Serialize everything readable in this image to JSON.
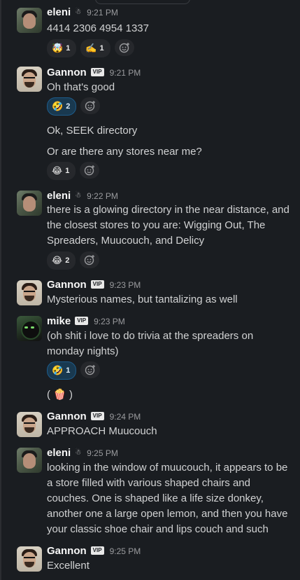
{
  "messages": [
    {
      "author": "eleni",
      "badge_icon": "snowman-icon",
      "badge": "☃",
      "time": "9:21 PM",
      "lines": [
        "4414 2306 4954 1337"
      ],
      "reactions": [
        {
          "emoji": "🤯",
          "icon": "exploding-head-icon",
          "count": "1",
          "active": false
        },
        {
          "emoji": "✍️",
          "icon": "writing-hand-icon",
          "count": "1",
          "active": false
        }
      ]
    },
    {
      "author": "Gannon",
      "vip": "VIP",
      "time": "9:21 PM",
      "lines": [
        "Oh that's good"
      ],
      "reactions": [
        {
          "emoji": "🤣",
          "icon": "rofl-icon",
          "count": "2",
          "active": true
        }
      ]
    },
    {
      "author": "",
      "time": "",
      "lines": [
        "Ok, SEEK directory"
      ]
    },
    {
      "author": "",
      "time": "",
      "lines": [
        "Or are there any stores near me?"
      ],
      "reactions": [
        {
          "emoji": "😂",
          "icon": "joy-icon",
          "count": "1",
          "active": false
        }
      ]
    },
    {
      "author": "eleni",
      "badge_icon": "snowman-icon",
      "badge": "☃",
      "time": "9:22 PM",
      "text": "there is a glowing directory in the near distance, and the closest stores to you are: Wigging Out, The Spreaders, Muucouch, and Delicy",
      "reactions": [
        {
          "emoji": "😂",
          "icon": "joy-icon",
          "count": "2",
          "active": false
        }
      ]
    },
    {
      "author": "Gannon",
      "vip": "VIP",
      "time": "9:23 PM",
      "text": "Mysterious names, but tantalizing as well"
    },
    {
      "author": "mike",
      "vip": "VIP",
      "time": "9:23 PM",
      "text": "(oh shit i love to do trivia at the spreaders on monday nights)",
      "reactions": [
        {
          "emoji": "🤣",
          "icon": "rofl-icon",
          "count": "1",
          "active": true
        }
      ]
    },
    {
      "author": "",
      "time": "",
      "text": "( 🍿 )"
    },
    {
      "author": "Gannon",
      "vip": "VIP",
      "time": "9:24 PM",
      "text": "APPROACH Muucouch"
    },
    {
      "author": "eleni",
      "badge_icon": "snowman-icon",
      "badge": "☃",
      "time": "9:25 PM",
      "text": "looking in the window of muucouch, it appears to be a store filled with various shaped chairs and couches. One is shaped like a life size donkey, another one a large open lemon, and then you have your classic shoe chair and lips couch and such"
    },
    {
      "author": "Gannon",
      "vip": "VIP",
      "time": "9:25 PM",
      "text": "Excellent"
    }
  ],
  "icons": {
    "add_reaction": "add-reaction-icon"
  },
  "colors": {
    "background": "#1a1d21",
    "active_reaction": "#193950",
    "active_reaction_border": "#1d5b8a"
  }
}
